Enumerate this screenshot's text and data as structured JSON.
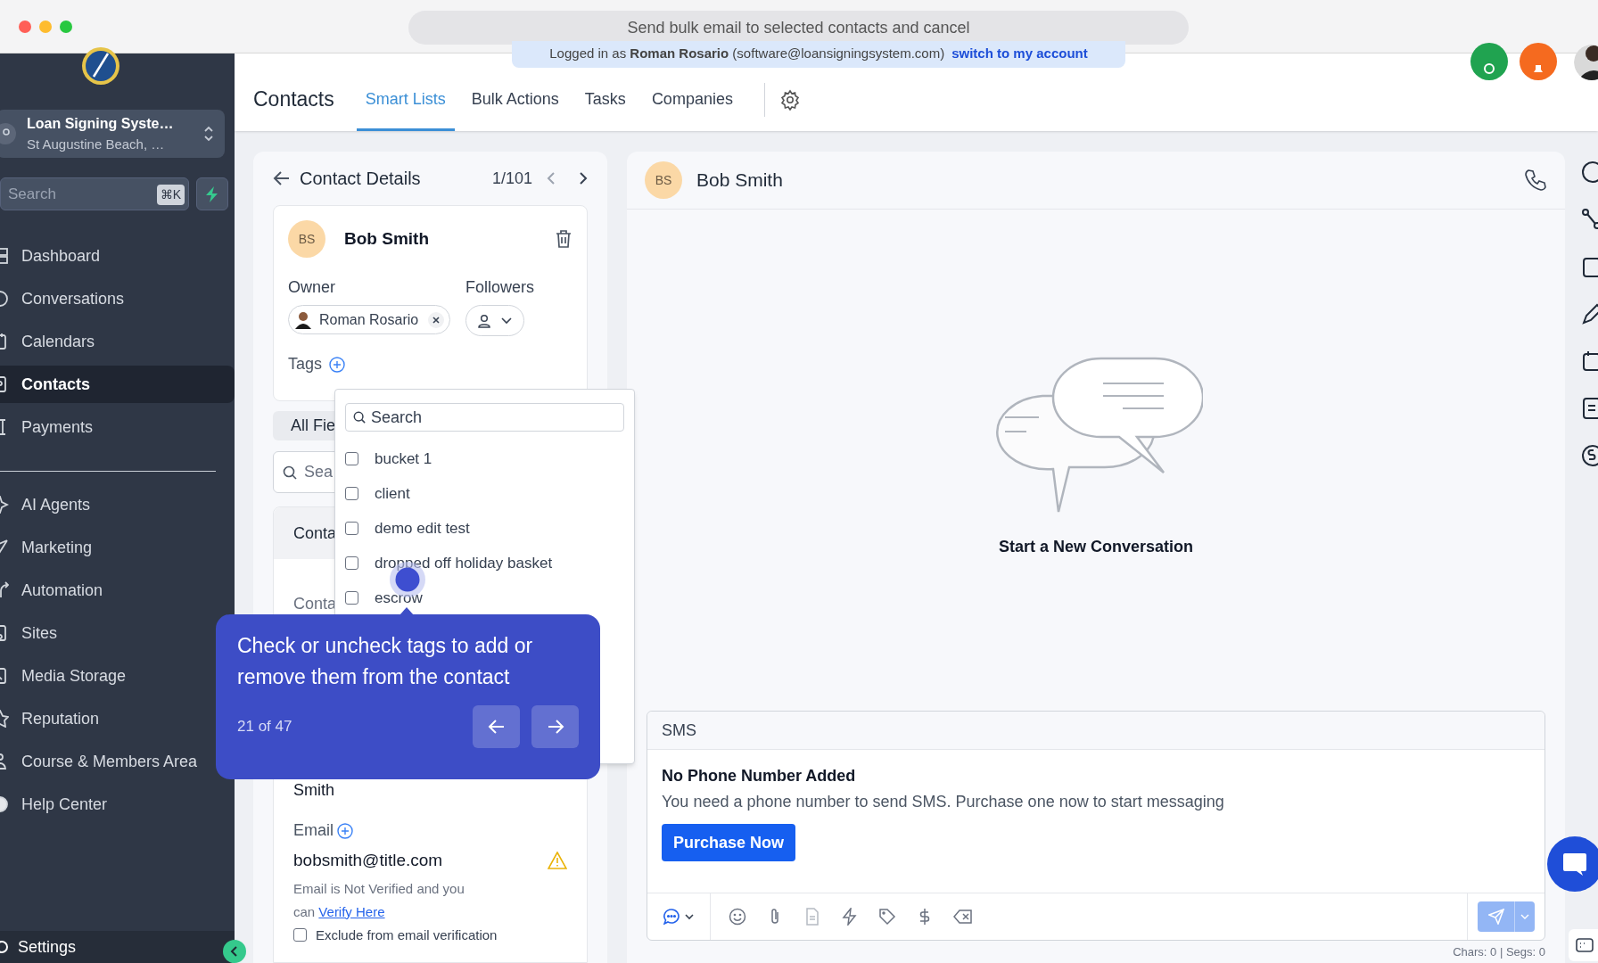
{
  "window": {
    "title": "Send bulk email to selected contacts and cancel"
  },
  "banner": {
    "text": "Logged in as **Roman Rosario** (software@loansigningsystem.com)",
    "link": "switch to my account"
  },
  "sidebar": {
    "account": {
      "name": "Loan Signing Syste…",
      "location": "St Augustine Beach, …"
    },
    "search": {
      "placeholder": "Search",
      "shortcut": "⌘K"
    },
    "primary_items": [
      {
        "label": "Dashboard",
        "selected": false
      },
      {
        "label": "Conversations",
        "selected": false
      },
      {
        "label": "Calendars",
        "selected": false
      },
      {
        "label": "Contacts",
        "selected": true
      },
      {
        "label": "Payments",
        "selected": false
      }
    ],
    "secondary_items": [
      {
        "label": "AI Agents",
        "selected": false
      },
      {
        "label": "Marketing",
        "selected": false
      },
      {
        "label": "Automation",
        "selected": false
      },
      {
        "label": "Sites",
        "selected": false
      },
      {
        "label": "Media Storage",
        "selected": false
      },
      {
        "label": "Reputation",
        "selected": false
      },
      {
        "label": "Course & Members Area",
        "selected": false
      },
      {
        "label": "Help Center",
        "selected": false
      }
    ],
    "settings": "Settings"
  },
  "header": {
    "title": "Contacts",
    "tabs": [
      {
        "label": "Smart Lists",
        "selected": true
      },
      {
        "label": "Bulk Actions",
        "selected": false
      },
      {
        "label": "Tasks",
        "selected": false
      },
      {
        "label": "Companies",
        "selected": false
      }
    ]
  },
  "contact_panel": {
    "title": "Contact Details",
    "position": "1/101",
    "contact": {
      "initials": "BS",
      "name": "Bob Smith"
    },
    "owner_label": "Owner",
    "owner": "Roman Rosario",
    "followers_label": "Followers",
    "tags_label": "Tags",
    "fields_tab": "All Fie",
    "search_placeholder": "Sea",
    "section_title": "Conta",
    "field_label": "Conta",
    "last_name": "Smith",
    "email_label": "Email",
    "email": "bobsmith@title.com",
    "email_note": "Email is Not Verified and you can",
    "verify_link": "Verify Here",
    "exclude": {
      "label": "Exclude from email verification",
      "checked": false
    }
  },
  "tag_dropdown": {
    "search_placeholder": "Search",
    "tags": [
      {
        "label": "bucket 1",
        "checked": false
      },
      {
        "label": "client",
        "checked": false
      },
      {
        "label": "demo edit test",
        "checked": false
      },
      {
        "label": "dropped off holiday basket",
        "checked": false
      },
      {
        "label": "escrow",
        "checked": false
      }
    ]
  },
  "tour": {
    "text": "Check or uncheck tags to add or remove them from the contact",
    "step": "21 of 47"
  },
  "conversation": {
    "contact": {
      "initials": "BS",
      "name": "Bob Smith"
    },
    "empty_title": "Start a New Conversation",
    "composer": {
      "channel": "SMS",
      "notice_title": "No Phone Number Added",
      "notice_text": "You need a phone number to send SMS. Purchase one now to start messaging",
      "button": "Purchase Now",
      "counter": "Chars: 0 | Segs: 0"
    }
  }
}
